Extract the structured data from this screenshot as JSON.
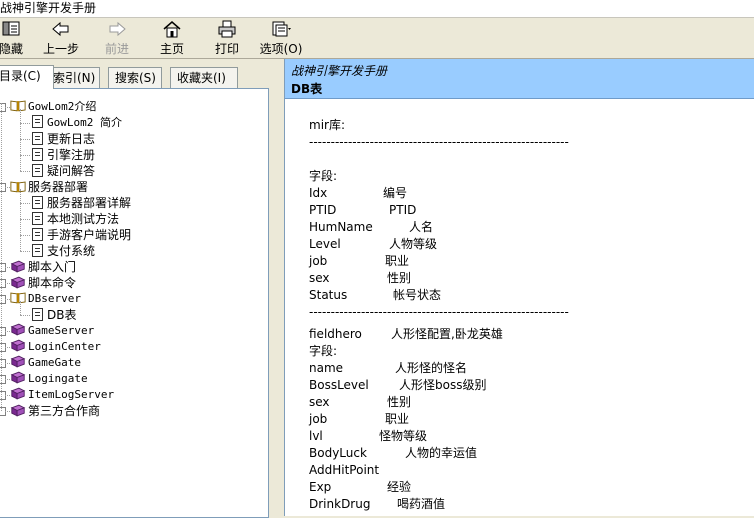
{
  "window": {
    "title": "战神引擎开发手册"
  },
  "toolbar": {
    "buttons": [
      {
        "id": "hide",
        "label": "隐藏",
        "icon": "hide-pane-icon"
      },
      {
        "id": "back",
        "label": "上一步",
        "icon": "back-arrow-icon"
      },
      {
        "id": "forward",
        "label": "前进",
        "icon": "forward-arrow-icon"
      },
      {
        "id": "home",
        "label": "主页",
        "icon": "home-icon"
      },
      {
        "id": "print",
        "label": "打印",
        "icon": "printer-icon"
      },
      {
        "id": "options",
        "label": "选项(O)",
        "icon": "options-icon"
      }
    ]
  },
  "tabs": [
    {
      "label": "目录(C)",
      "active": true
    },
    {
      "label": "索引(N)",
      "active": false
    },
    {
      "label": "搜索(S)",
      "active": false
    },
    {
      "label": "收藏夹(I)",
      "active": false
    }
  ],
  "tree": [
    {
      "label": "GowLom2介绍",
      "type": "book-open",
      "level": 0,
      "mono": true
    },
    {
      "label": "GowLom2 简介",
      "type": "page",
      "level": 1,
      "mono": true
    },
    {
      "label": "更新日志",
      "type": "page",
      "level": 1
    },
    {
      "label": "引擎注册",
      "type": "page",
      "level": 1
    },
    {
      "label": "疑问解答",
      "type": "page",
      "level": 1
    },
    {
      "label": "服务器部署",
      "type": "book-open",
      "level": 0
    },
    {
      "label": "服务器部署详解",
      "type": "page",
      "level": 1
    },
    {
      "label": "本地测试方法",
      "type": "page",
      "level": 1
    },
    {
      "label": "手游客户端说明",
      "type": "page",
      "level": 1
    },
    {
      "label": "支付系统",
      "type": "page",
      "level": 1
    },
    {
      "label": "脚本入门",
      "type": "book",
      "level": 0
    },
    {
      "label": "脚本命令",
      "type": "book",
      "level": 0
    },
    {
      "label": "DBserver",
      "type": "book-open",
      "level": 0,
      "mono": true
    },
    {
      "label": "DB表",
      "type": "page",
      "level": 1
    },
    {
      "label": "GameServer",
      "type": "book",
      "level": 0,
      "mono": true
    },
    {
      "label": "LoginCenter",
      "type": "book",
      "level": 0,
      "mono": true
    },
    {
      "label": "GameGate",
      "type": "book",
      "level": 0,
      "mono": true
    },
    {
      "label": "Logingate",
      "type": "book",
      "level": 0,
      "mono": true
    },
    {
      "label": "ItemLogServer",
      "type": "book",
      "level": 0,
      "mono": true
    },
    {
      "label": "第三方合作商",
      "type": "book",
      "level": 0
    }
  ],
  "topic": {
    "breadcrumb": "战神引擎开发手册",
    "title": "DB表"
  },
  "content": [
    {
      "key": "mir库:",
      "val": ""
    },
    {
      "key": "------------------------------------------------------------",
      "val": "",
      "gap": true
    },
    {
      "key": "字段:",
      "val": ""
    },
    {
      "key": "Idx",
      "val": "编号"
    },
    {
      "key": "PTID",
      "val": "PTID"
    },
    {
      "key": "HumName",
      "val": "人名"
    },
    {
      "key": "Level",
      "val": "人物等级"
    },
    {
      "key": "job",
      "val": "职业"
    },
    {
      "key": "sex",
      "val": "性别"
    },
    {
      "key": "Status",
      "val": "帐号状态"
    },
    {
      "key": "------------------------------------------------------------",
      "val": ""
    },
    {
      "key": "fieldhero",
      "val": "人形怪配置,卧龙英雄"
    },
    {
      "key": "字段:",
      "val": ""
    },
    {
      "key": "name",
      "val": "人形怪的怪名"
    },
    {
      "key": "BossLevel",
      "val": "人形怪boss级别"
    },
    {
      "key": "sex",
      "val": "性别"
    },
    {
      "key": "job",
      "val": "职业"
    },
    {
      "key": "lvl",
      "val": "怪物等级"
    },
    {
      "key": "BodyLuck",
      "val": "人物的幸运值"
    },
    {
      "key": "AddHitPoint",
      "val": ""
    },
    {
      "key": "Exp",
      "val": "经验"
    },
    {
      "key": "DrinkDrug",
      "val": "喝药酒值"
    }
  ]
}
